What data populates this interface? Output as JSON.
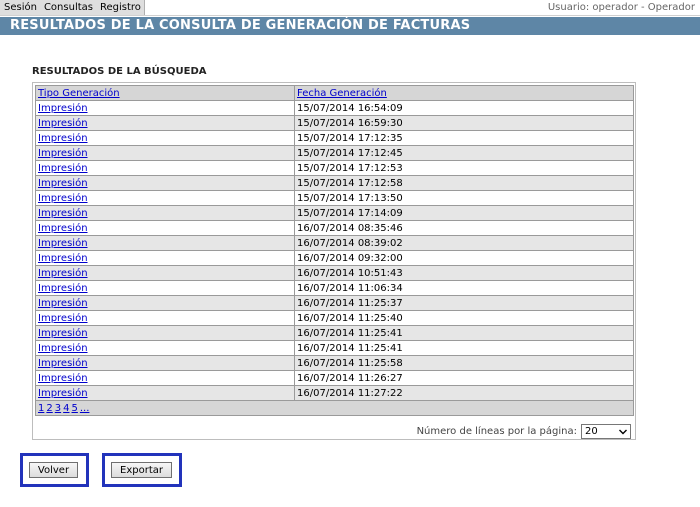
{
  "menu": {
    "items": [
      "Sesión",
      "Consultas",
      "Registro"
    ]
  },
  "user_info": "Usuario: operador - Operador",
  "page_title": "RESULTADOS DE LA CONSULTA DE GENERACIÓN DE FACTURAS",
  "section_title": "RESULTADOS DE LA BÚSQUEDA",
  "table": {
    "headers": [
      "Tipo Generación",
      "Fecha Generación"
    ],
    "rows": [
      [
        "Impresión",
        "15/07/2014 16:54:09"
      ],
      [
        "Impresión",
        "15/07/2014 16:59:30"
      ],
      [
        "Impresión",
        "15/07/2014 17:12:35"
      ],
      [
        "Impresión",
        "15/07/2014 17:12:45"
      ],
      [
        "Impresión",
        "15/07/2014 17:12:53"
      ],
      [
        "Impresión",
        "15/07/2014 17:12:58"
      ],
      [
        "Impresión",
        "15/07/2014 17:13:50"
      ],
      [
        "Impresión",
        "15/07/2014 17:14:09"
      ],
      [
        "Impresión",
        "16/07/2014 08:35:46"
      ],
      [
        "Impresión",
        "16/07/2014 08:39:02"
      ],
      [
        "Impresión",
        "16/07/2014 09:32:00"
      ],
      [
        "Impresión",
        "16/07/2014 10:51:43"
      ],
      [
        "Impresión",
        "16/07/2014 11:06:34"
      ],
      [
        "Impresión",
        "16/07/2014 11:25:37"
      ],
      [
        "Impresión",
        "16/07/2014 11:25:40"
      ],
      [
        "Impresión",
        "16/07/2014 11:25:41"
      ],
      [
        "Impresión",
        "16/07/2014 11:25:41"
      ],
      [
        "Impresión",
        "16/07/2014 11:25:58"
      ],
      [
        "Impresión",
        "16/07/2014 11:26:27"
      ],
      [
        "Impresión",
        "16/07/2014 11:27:22"
      ]
    ]
  },
  "pager": {
    "pages": [
      "1",
      "2",
      "3",
      "4",
      "5",
      "..."
    ]
  },
  "lines_per_page": {
    "label": "Número de líneas por la página:",
    "selected": "20"
  },
  "buttons": {
    "back": "Volver",
    "export": "Exportar"
  },
  "colors": {
    "title_bar": "#5e86a6",
    "highlight_frame": "#2233bb",
    "link": "#0000cc"
  }
}
